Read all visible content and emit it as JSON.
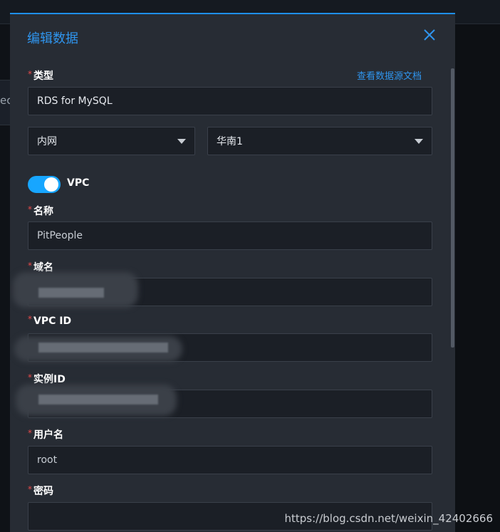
{
  "modal": {
    "title": "编辑数据",
    "doc_link": "查看数据源文档"
  },
  "fields": {
    "type": {
      "label": "类型",
      "value": "RDS for MySQL"
    },
    "network": {
      "value": "内网"
    },
    "region": {
      "value": "华南1"
    },
    "vpc_toggle": {
      "label": "VPC",
      "on": true
    },
    "name": {
      "label": "名称",
      "value": "PitPeople"
    },
    "domain": {
      "label": "域名",
      "value": ""
    },
    "vpc_id": {
      "label": "VPC ID",
      "value": ""
    },
    "instance_id": {
      "label": "实例ID",
      "value": ""
    },
    "username": {
      "label": "用户名",
      "value": "root"
    },
    "password": {
      "label": "密码",
      "value": ""
    }
  },
  "required_mark": "*",
  "background": {
    "left_fragment": "ec"
  },
  "watermark": "https://blog.csdn.net/weixin_42402666",
  "colors": {
    "accent": "#2f95ee",
    "toggle": "#17a6ff",
    "required": "#e64a4a",
    "modal_bg": "#272c34"
  },
  "icons": {
    "close": "close-icon",
    "caret": "caret-down-icon"
  }
}
